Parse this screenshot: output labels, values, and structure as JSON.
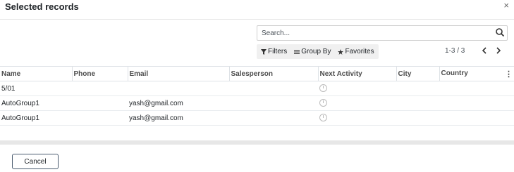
{
  "dialog": {
    "title": "Selected records",
    "close_symbol": "×"
  },
  "search": {
    "placeholder": "Search...",
    "icon": "search-icon"
  },
  "filters": {
    "filters_label": "Filters",
    "groupby_label": "Group By",
    "favorites_label": "Favorites"
  },
  "pager": {
    "value": "1-3 / 3"
  },
  "table": {
    "columns": [
      "Name",
      "Phone",
      "Email",
      "Salesperson",
      "Next Activity",
      "City",
      "Country"
    ],
    "rows": [
      {
        "name": "5/01",
        "phone": "",
        "email": "",
        "salesperson": "",
        "city": "",
        "country": ""
      },
      {
        "name": "AutoGroup1",
        "phone": "",
        "email": "yash@gmail.com",
        "salesperson": "",
        "city": "",
        "country": ""
      },
      {
        "name": "AutoGroup1",
        "phone": "",
        "email": "yash@gmail.com",
        "salesperson": "",
        "city": "",
        "country": ""
      }
    ]
  },
  "footer": {
    "cancel_label": "Cancel"
  }
}
